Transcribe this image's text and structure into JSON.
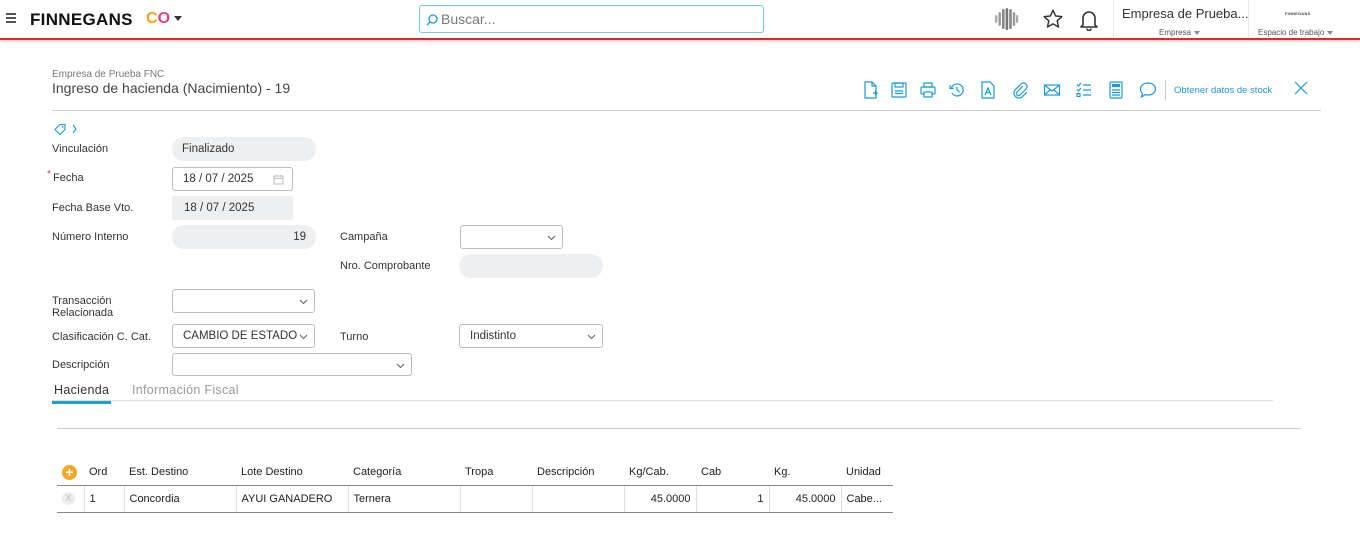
{
  "topbar": {
    "logo_text": "FINNEGANS",
    "logo_co_c": "C",
    "logo_co_o": "O",
    "search_placeholder": "Buscar...",
    "company_name": "Empresa de Prueba...",
    "company_label": "Empresa",
    "workspace_logo_text": "FINNEGANS",
    "workspace_label": "Espacio de trabajo",
    "accent_color": "#d32f2f"
  },
  "header": {
    "subtitle": "Empresa de Prueba FNC",
    "title": "Ingreso de hacienda (Nacimiento) - 19",
    "stock_link": "Obtener datos de stock",
    "toolbar_icons": [
      "new-document-icon",
      "save-icon",
      "print-icon",
      "history-icon",
      "text-document-icon",
      "attachment-icon",
      "email-icon",
      "checklist-icon",
      "report-icon",
      "comment-icon"
    ]
  },
  "form": {
    "vinculacion_label": "Vinculación",
    "vinculacion_value": "Finalizado",
    "fecha_required": "*",
    "fecha_label": "Fecha",
    "fecha_value": "18 / 07 / 2025",
    "fecha_base_label": "Fecha Base Vto.",
    "fecha_base_value": "18 / 07 / 2025",
    "numero_label": "Número Interno",
    "numero_value": "19",
    "campana_label": "Campaña",
    "campana_value": "",
    "nro_comprobante_label": "Nro. Comprobante",
    "nro_comprobante_value": "",
    "transaccion_label_1": "Transacción",
    "transaccion_label_2": "Relacionada",
    "transaccion_value": "",
    "clasificacion_label": "Clasificación C. Cat.",
    "clasificacion_value": "CAMBIO DE ESTADO",
    "turno_label": "Turno",
    "turno_value": "Indistinto",
    "descripcion_label": "Descripción",
    "descripcion_value": ""
  },
  "tabs": [
    {
      "label": "Hacienda",
      "active": true
    },
    {
      "label": "Información Fiscal",
      "active": false
    }
  ],
  "grid": {
    "add_symbol": "+",
    "delete_symbol": "X",
    "columns": [
      "Ord",
      "Est. Destino",
      "Lote Destino",
      "Categoría",
      "Tropa",
      "Descripción",
      "Kg/Cab.",
      "Cab",
      "Kg.",
      "Unidad"
    ],
    "rows": [
      [
        "1",
        "Concordia",
        "AYUI GANADERO",
        "Ternera",
        "",
        "",
        "45.0000",
        "1",
        "45.0000",
        "Cabe..."
      ]
    ]
  }
}
